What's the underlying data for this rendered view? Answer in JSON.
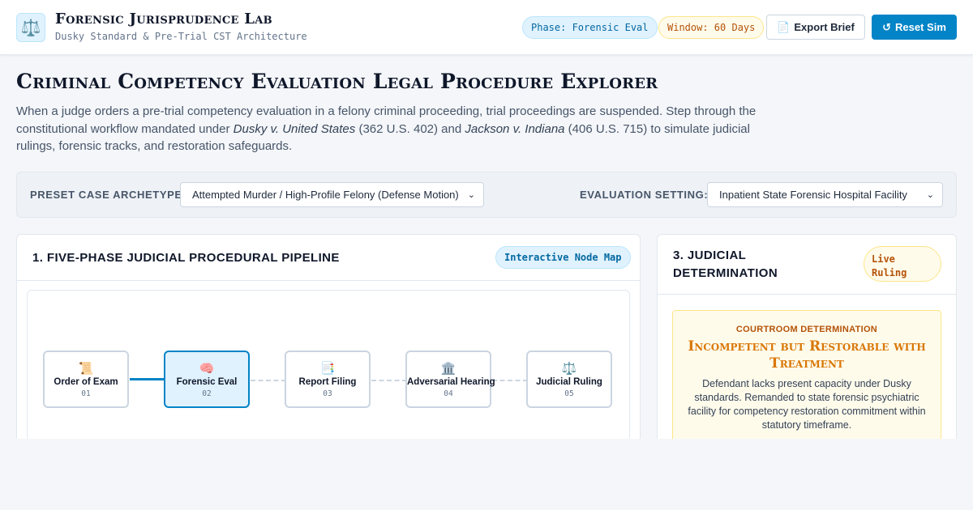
{
  "header": {
    "logo_icon": "scales-icon",
    "title": "Forensic Jurisprudence Lab",
    "subtitle": "Dusky Standard & Pre-Trial CST Architecture",
    "phase_badge": "Phase: Forensic Eval",
    "window_badge": "Window: 60 Days",
    "export_icon": "📄",
    "export_label": "Export Brief",
    "reset_icon": "↺",
    "reset_label": "Reset Sim"
  },
  "intro": {
    "title": "Criminal Competency Evaluation Legal Procedure Explorer",
    "text_1": "When a judge orders a pre-trial competency evaluation in a felony criminal proceeding, trial proceedings are suspended. Step through the constitutional workflow mandated under ",
    "case_1": "Dusky v. United States",
    "text_2": " (362 U.S. 402) and ",
    "case_2": "Jackson v. Indiana",
    "text_3": " (406 U.S. 715) to simulate judicial rulings, forensic tracks, and restoration safeguards."
  },
  "controls": {
    "archetype_label": "PRESET CASE ARCHETYPE:",
    "archetype_value": "Attempted Murder / High-Profile Felony (Defense Motion)",
    "setting_label": "EVALUATION SETTING:",
    "setting_value": "Inpatient State Forensic Hospital Facility"
  },
  "pipeline": {
    "title": "1. FIVE-PHASE JUDICIAL PROCEDURAL PIPELINE",
    "badge": "Interactive Node Map",
    "active_index": 1,
    "nodes": [
      {
        "icon": "📜",
        "label": "Order of Exam",
        "num": "01"
      },
      {
        "icon": "🧠",
        "label": "Forensic Eval",
        "num": "02"
      },
      {
        "icon": "📑",
        "label": "Report Filing",
        "num": "03"
      },
      {
        "icon": "🏛️",
        "label": "Adversarial Hearing",
        "num": "04"
      },
      {
        "icon": "⚖️",
        "label": "Judicial Ruling",
        "num": "05"
      }
    ]
  },
  "determination": {
    "title": "3. JUDICIAL DETERMINATION",
    "badge": "Live Ruling",
    "kicker": "COURTROOM DETERMINATION",
    "ruling": "Incompetent but Restorable with Treatment",
    "body": "Defendant lacks present capacity under Dusky standards. Remanded to state forensic psychiatric facility for competency restoration commitment within statutory timeframe."
  }
}
